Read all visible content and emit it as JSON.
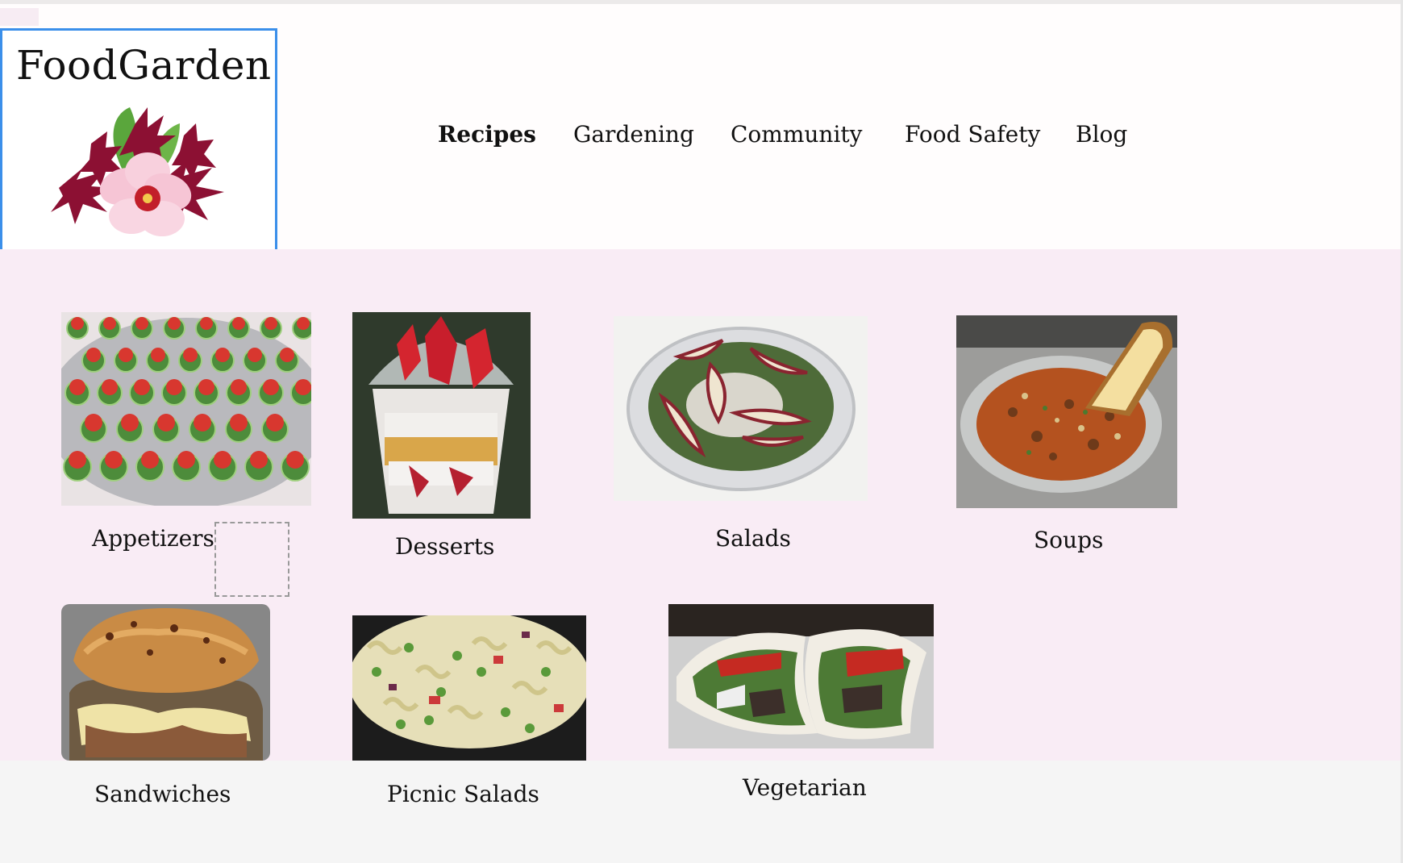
{
  "brand": {
    "name": "FoodGarden",
    "logo_icon": "hibiscus-flower-logo"
  },
  "nav": {
    "items": [
      {
        "label": "Recipes",
        "active": true
      },
      {
        "label": "Gardening",
        "active": false
      },
      {
        "label": "Community",
        "active": false
      },
      {
        "label": "Food Safety",
        "active": false
      },
      {
        "label": "Blog",
        "active": false
      }
    ]
  },
  "categories": [
    {
      "label": "Appetizers",
      "image": "appetizers-photo"
    },
    {
      "label": "Desserts",
      "image": "desserts-photo"
    },
    {
      "label": "Salads",
      "image": "salads-photo"
    },
    {
      "label": "Soups",
      "image": "soups-photo"
    },
    {
      "label": "Sandwiches",
      "image": "sandwiches-photo"
    },
    {
      "label": "Picnic Salads",
      "image": "picnic-salads-photo"
    },
    {
      "label": "Vegetarian",
      "image": "vegetarian-photo"
    }
  ],
  "colors": {
    "header_bg": "#fffdfd",
    "main_bg": "#f9ecf5",
    "footer_bg": "#f5f5f5",
    "logo_border": "#3b8fea"
  }
}
